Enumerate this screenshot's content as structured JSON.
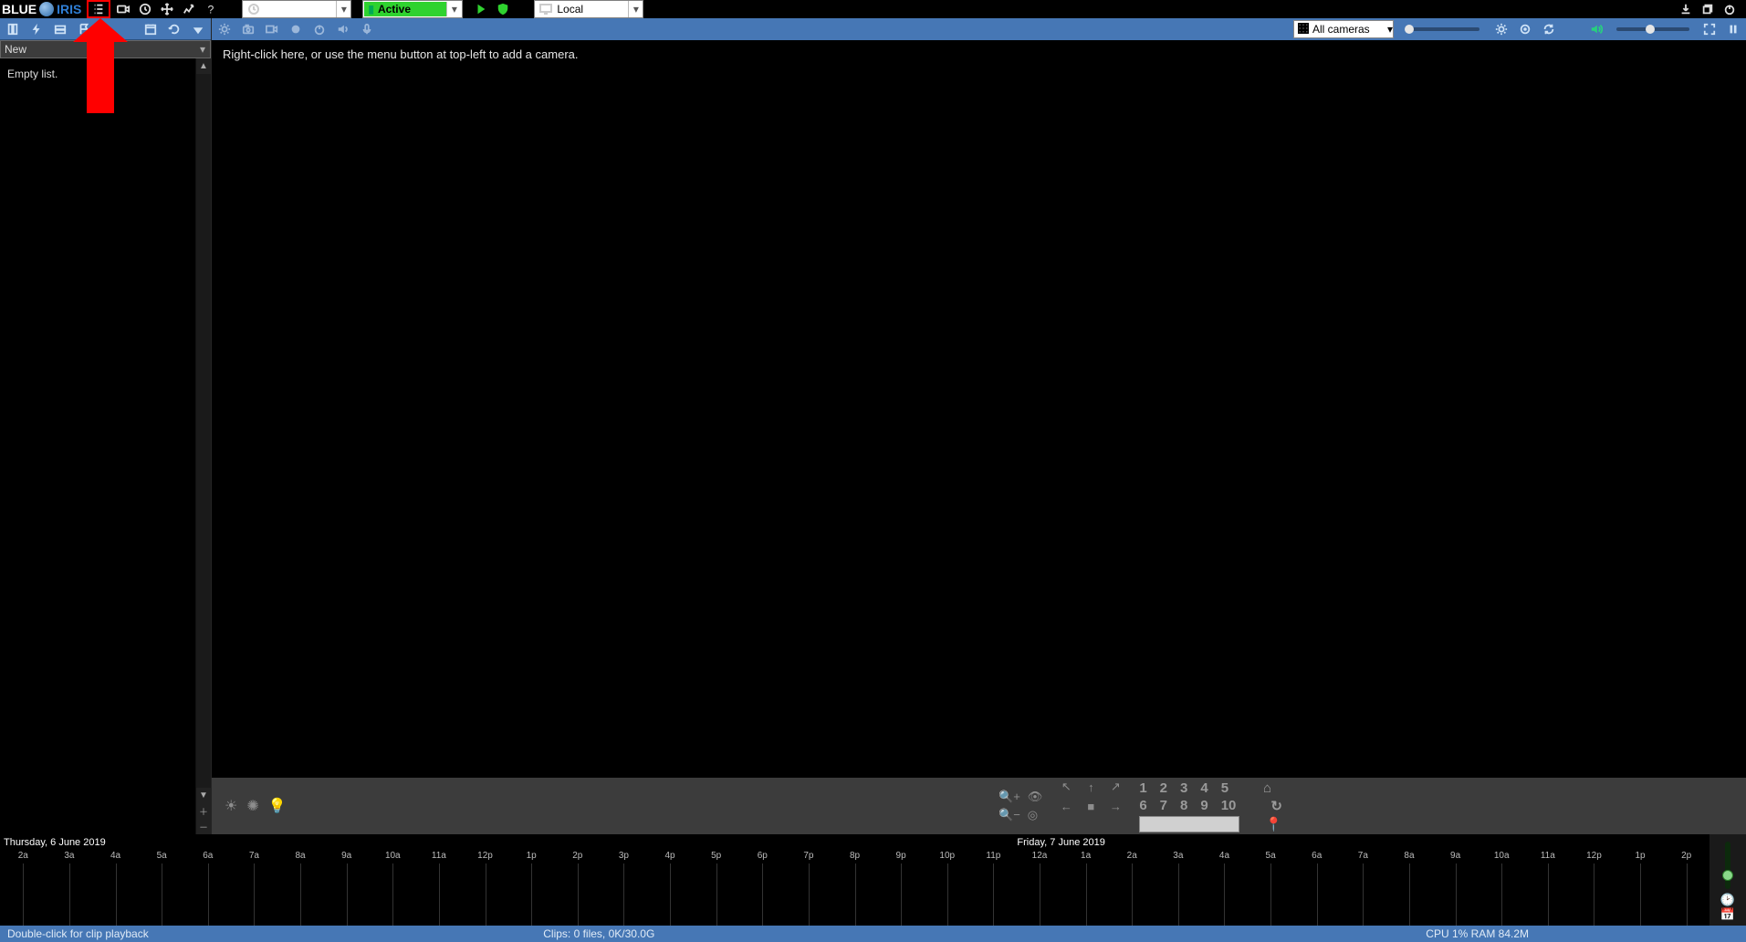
{
  "app": {
    "name1": "BLUE",
    "name2": "IRIS"
  },
  "top_toolbar": {
    "profile_dd": "",
    "active_dd": "Active",
    "local_dd": "Local"
  },
  "sidebar": {
    "filter_dd": "New",
    "empty": "Empty list."
  },
  "video_toolbar": {
    "camera_dd": "All cameras"
  },
  "video_hint": "Right-click here, or use the menu button at top-left to add a camera.",
  "ptz": {
    "presets_row1": [
      "1",
      "2",
      "3",
      "4",
      "5"
    ],
    "presets_row2": [
      "6",
      "7",
      "8",
      "9",
      "10"
    ]
  },
  "timeline": {
    "dates": [
      "Thursday, 6 June 2019",
      "Friday, 7 June 2019"
    ],
    "hours": [
      "2a",
      "3a",
      "4a",
      "5a",
      "6a",
      "7a",
      "8a",
      "9a",
      "10a",
      "11a",
      "12p",
      "1p",
      "2p",
      "3p",
      "4p",
      "5p",
      "6p",
      "7p",
      "8p",
      "9p",
      "10p",
      "11p",
      "12a",
      "1a",
      "2a",
      "3a",
      "4a",
      "5a",
      "6a",
      "7a",
      "8a",
      "9a",
      "10a",
      "11a",
      "12p",
      "1p",
      "2p"
    ]
  },
  "status": {
    "left": "Double-click for clip playback",
    "center": "Clips: 0 files, 0K/30.0G",
    "right": "CPU 1% RAM 84.2M"
  }
}
